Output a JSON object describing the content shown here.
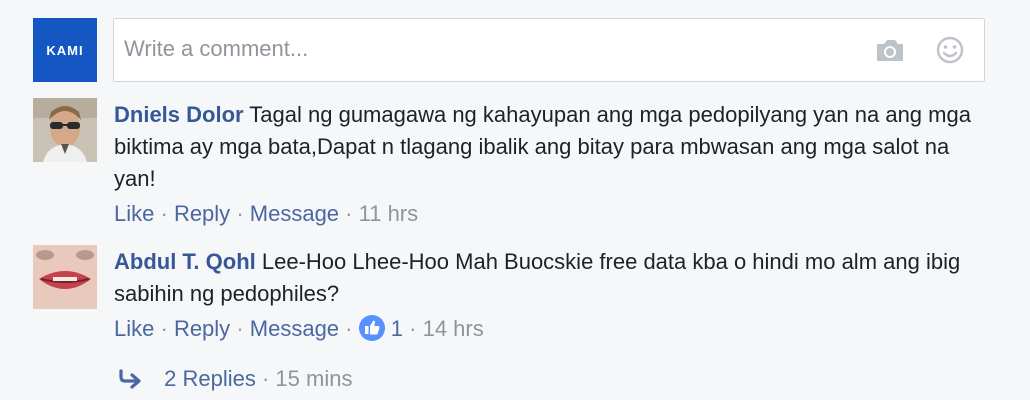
{
  "composer": {
    "logo_text": "KAMI",
    "placeholder": "Write a comment...",
    "camera_icon": "camera-icon",
    "emoji_icon": "smiley-icon"
  },
  "comments": [
    {
      "author": "Dniels Dolor",
      "text": "Tagal ng gumagawa ng kahayupan ang mga pedopilyang yan na ang mga biktima ay mga bata,Dapat n tlagang ibalik ang bitay para mbwasan ang mga salot na yan!",
      "like_label": "Like",
      "reply_label": "Reply",
      "message_label": "Message",
      "separator": "·",
      "time": "11 hrs"
    },
    {
      "author": "Abdul T. Qohl",
      "text": "Lee-Hoo Lhee-Hoo Mah Buocskie free data kba o hindi mo alm ang ibig sabihin ng pedophiles?",
      "like_label": "Like",
      "reply_label": "Reply",
      "message_label": "Message",
      "separator": "·",
      "reactions_count": "1",
      "reaction_icon": "thumbs-up-icon",
      "time": "14 hrs"
    }
  ],
  "replies": {
    "label": "2 Replies",
    "separator": "·",
    "time": "15 mins"
  },
  "colors": {
    "background": "#f6f7f9",
    "link": "#4b67a1",
    "author": "#365899",
    "meta": "#90949c",
    "brand": "#1457c2",
    "like": "#5890ff"
  }
}
